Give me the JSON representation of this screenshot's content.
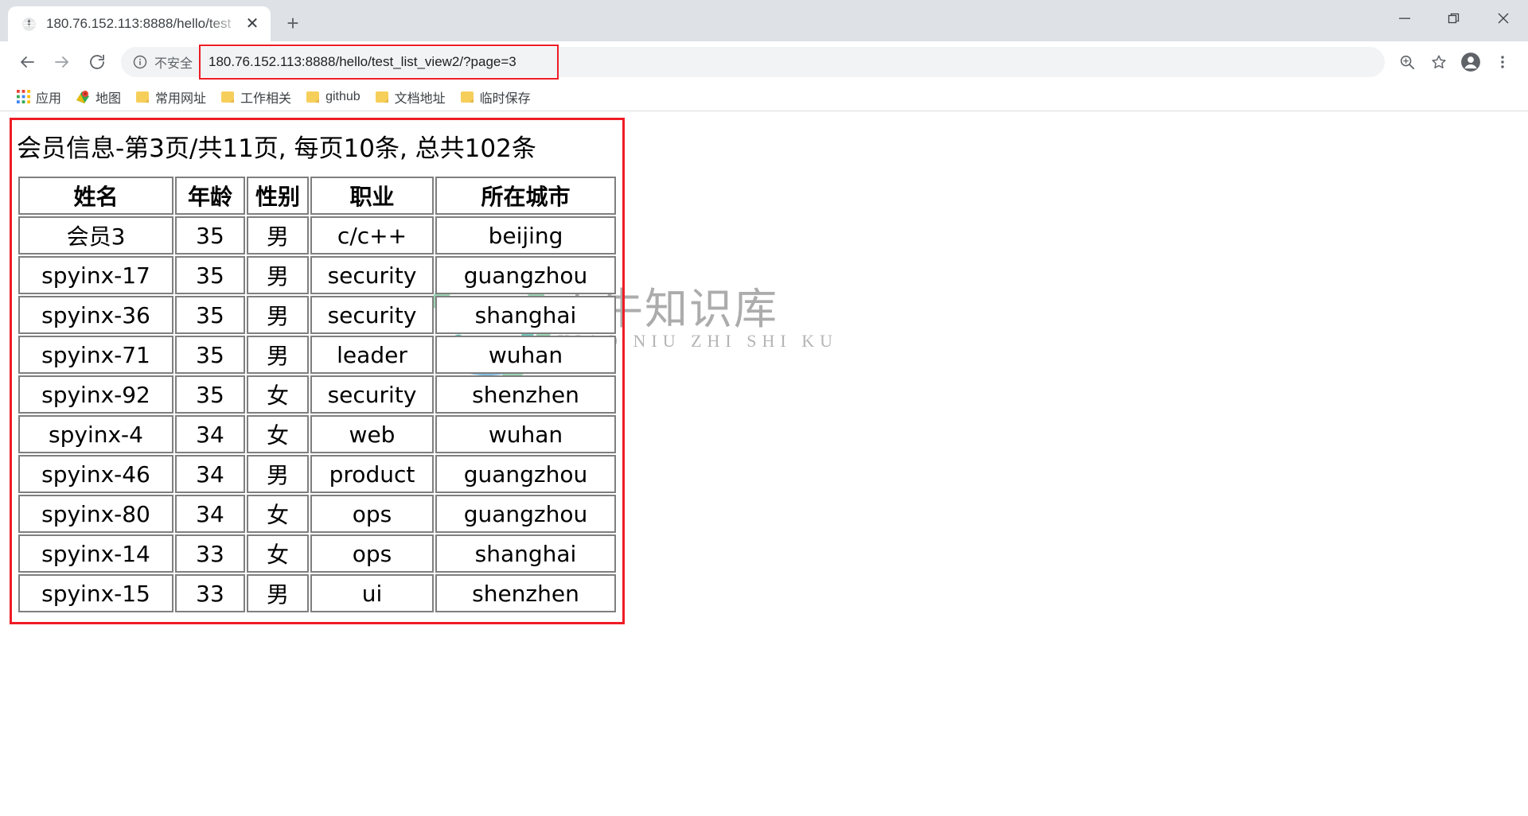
{
  "browser": {
    "tab": {
      "favicon": "globe-icon",
      "title": "180.76.152.113:8888/hello/test",
      "close_label": "✕"
    },
    "newtab_label": "+",
    "window_controls": {
      "minimize": "—",
      "restore": "restore-icon",
      "close": "✕"
    },
    "toolbar": {
      "back": "←",
      "forward": "→",
      "reload": "↻",
      "security_label": "不安全",
      "url": "180.76.152.113:8888/hello/test_list_view2/?page=3",
      "zoom_icon": "zoom-in-icon",
      "bookmark_icon": "star-icon",
      "profile_icon": "profile-avatar-icon",
      "menu_icon": "three-dot-menu-icon"
    },
    "bookmarks": [
      {
        "label": "应用",
        "icon": "apps-grid-icon"
      },
      {
        "label": "地图",
        "icon": "maps-pin-icon"
      },
      {
        "label": "常用网址",
        "icon": "folder-icon"
      },
      {
        "label": "工作相关",
        "icon": "folder-icon"
      },
      {
        "label": "github",
        "icon": "folder-icon"
      },
      {
        "label": "文档地址",
        "icon": "folder-icon"
      },
      {
        "label": "临时保存",
        "icon": "folder-icon"
      }
    ]
  },
  "page": {
    "title": "会员信息-第3页/共11页, 每页10条, 总共102条",
    "pagination": {
      "current_page": 3,
      "total_pages": 11,
      "per_page": 10,
      "total_items": 102
    },
    "table": {
      "headers": [
        "姓名",
        "年龄",
        "性别",
        "职业",
        "所在城市"
      ],
      "rows": [
        {
          "name": "会员3",
          "age": "35",
          "sex": "男",
          "job": "c/c++",
          "city": "beijing"
        },
        {
          "name": "spyinx-17",
          "age": "35",
          "sex": "男",
          "job": "security",
          "city": "guangzhou"
        },
        {
          "name": "spyinx-36",
          "age": "35",
          "sex": "男",
          "job": "security",
          "city": "shanghai"
        },
        {
          "name": "spyinx-71",
          "age": "35",
          "sex": "男",
          "job": "leader",
          "city": "wuhan"
        },
        {
          "name": "spyinx-92",
          "age": "35",
          "sex": "女",
          "job": "security",
          "city": "shenzhen"
        },
        {
          "name": "spyinx-4",
          "age": "34",
          "sex": "女",
          "job": "web",
          "city": "wuhan"
        },
        {
          "name": "spyinx-46",
          "age": "34",
          "sex": "男",
          "job": "product",
          "city": "guangzhou"
        },
        {
          "name": "spyinx-80",
          "age": "34",
          "sex": "女",
          "job": "ops",
          "city": "guangzhou"
        },
        {
          "name": "spyinx-14",
          "age": "33",
          "sex": "女",
          "job": "ops",
          "city": "shanghai"
        },
        {
          "name": "spyinx-15",
          "age": "33",
          "sex": "男",
          "job": "ui",
          "city": "shenzhen"
        }
      ]
    },
    "watermark": {
      "text": "小牛知识库",
      "subtext": "XIAO NIU ZHI SHI KU"
    },
    "annotation_color": "#ee1c25"
  }
}
